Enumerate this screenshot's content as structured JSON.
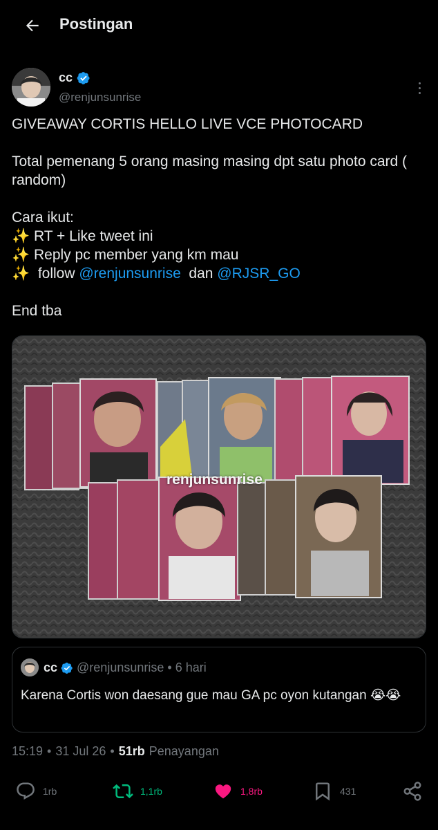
{
  "header": {
    "title": "Postingan",
    "back_icon": "arrow-left-icon"
  },
  "author": {
    "name": "cc",
    "handle": "@renjunsunrise",
    "verified": true
  },
  "tweet": {
    "line1": "GIVEAWAY CORTIS HELLO LIVE VCE PHOTOCARD",
    "line2": "Total pemenang 5 orang masing masing dpt satu photo card ( random)",
    "line3": "Cara ikut:",
    "line4_emoji": "✨",
    "line4_text": " RT + Like tweet ini",
    "line5_emoji": "✨",
    "line5_text": " Reply pc member yang km mau",
    "line6_emoji": "✨",
    "line6_text": "  follow ",
    "line6_link1": "@renjunsunrise",
    "line6_mid": "  dan ",
    "line6_link2": "@RJSR_GO",
    "line7": "End tba"
  },
  "media": {
    "watermark": "renjunsunrise"
  },
  "quote": {
    "name": "cc",
    "handle": "@renjunsunrise",
    "dot": "•",
    "time": "6 hari",
    "text": "Karena Cortis won daesang gue mau GA pc oyon kutangan 😭😭"
  },
  "meta": {
    "time": "15:19",
    "dot1": "•",
    "date": "31 Jul 26",
    "dot2": "•",
    "views_count": "51rb",
    "views_label": "Penayangan"
  },
  "actions": {
    "reply": "1rb",
    "retweet": "1,1rb",
    "like": "1,8rb",
    "bookmark": "431"
  },
  "colors": {
    "accent": "#1d9bf0",
    "retweet": "#00ba7c",
    "like": "#f91880",
    "muted": "#71767b",
    "text": "#e7e9ea",
    "background": "#000000"
  }
}
